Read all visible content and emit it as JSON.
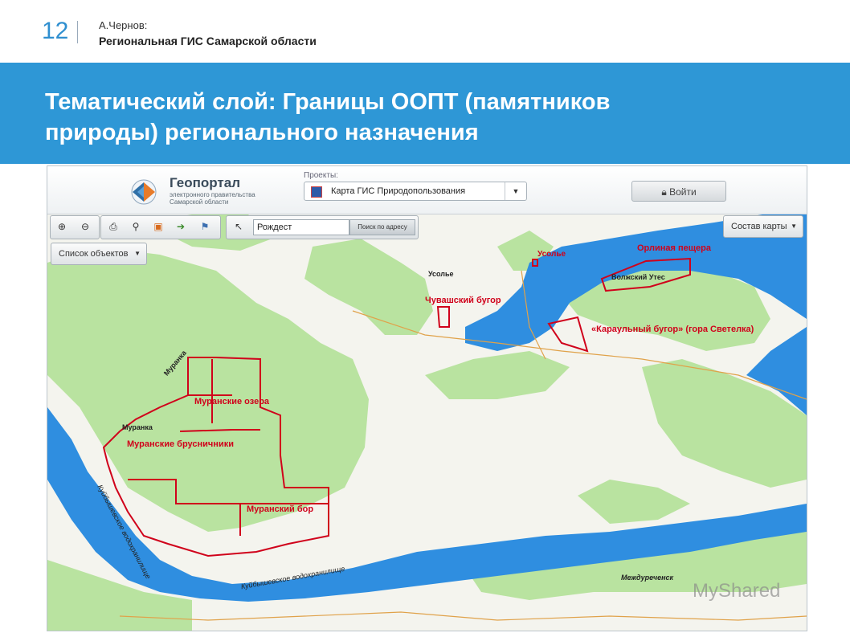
{
  "slide": {
    "number": "12",
    "author": "А.Чернов:",
    "subtitle": "Региональная ГИС Самарской области",
    "title_line1": "Тематический слой: Границы  ООПТ (памятников",
    "title_line2": "природы)  регионального назначения"
  },
  "geoportal": {
    "logo_name": "Геопортал",
    "logo_sub": "электронного правительства Самарской области",
    "projects_label": "Проекты:",
    "project_selected": "Карта ГИС Природопользования",
    "login_label": "Войти"
  },
  "toolbar": {
    "search_value": "Рождест",
    "search_button": "Поиск по адресу",
    "layers_button": "Состав карты",
    "objects_button": "Список объектов"
  },
  "map_labels": {
    "muranskie_ozera": "Муранские озера",
    "muranskie_brusnichniki": "Муранские брусничники",
    "muranskiy_bor": "Муранский бор",
    "chuvashskiy_bugor": "Чувашский бугор",
    "orlinaya_peshchera": "Орлиная пещера",
    "karaulny_bugor": "«Караульный бугор» (гора Светелка)",
    "usolye_red": "Усолье",
    "usolye": "Усолье",
    "murankа_town": "Муранка",
    "murankа_river": "Муранка",
    "volzhskiy_utes": "Волжский Утес",
    "mezhdurechensk": "Междуреченск",
    "reservoir_1": "Куйбышевское водохранилище",
    "reservoir_2": "Куйбышевское водохранилище"
  },
  "watermark": "MyShared",
  "colors": {
    "banner": "#2e97d6",
    "slide_number": "#2f8fd0",
    "water": "#2f8ee0",
    "forest": "#b9e3a0",
    "field": "#f4f4ee",
    "boundary": "#d0021b"
  },
  "icons": [
    "zoom-in-icon",
    "zoom-out-icon",
    "print-icon",
    "link-icon",
    "add-layer-icon",
    "export-icon",
    "pin-icon",
    "select-icon",
    "dropdown-arrow-icon",
    "lock-icon"
  ]
}
